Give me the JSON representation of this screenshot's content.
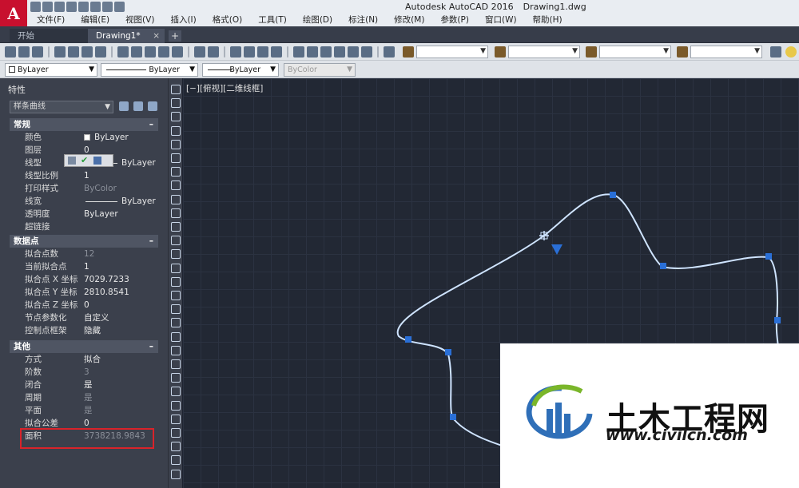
{
  "titlebar": {
    "app_name": "Autodesk AutoCAD 2016",
    "doc_name": "Drawing1.dwg",
    "app_button_letter": "A"
  },
  "menu": [
    "文件(F)",
    "编辑(E)",
    "视图(V)",
    "插入(I)",
    "格式(O)",
    "工具(T)",
    "绘图(D)",
    "标注(N)",
    "修改(M)",
    "参数(P)",
    "窗口(W)",
    "帮助(H)"
  ],
  "tabs": {
    "start": "开始",
    "active": "Drawing1*",
    "add": "+"
  },
  "layer_toolbar": {
    "color": "ByLayer",
    "linetype": "ByLayer",
    "lineweight": "ByLayer",
    "plotstyle": "ByColor"
  },
  "properties": {
    "panel_title": "特性",
    "object_type": "样条曲线",
    "sections": {
      "general": {
        "title": "常规",
        "rows": [
          {
            "label": "颜色",
            "value": "ByLayer"
          },
          {
            "label": "图层",
            "value": "0"
          },
          {
            "label": "线型",
            "value": "ByLayer"
          },
          {
            "label": "线型比例",
            "value": "1"
          },
          {
            "label": "打印样式",
            "value": "ByColor"
          },
          {
            "label": "线宽",
            "value": "ByLayer"
          },
          {
            "label": "透明度",
            "value": "ByLayer"
          },
          {
            "label": "超链接",
            "value": ""
          }
        ]
      },
      "data_points": {
        "title": "数据点",
        "rows": [
          {
            "label": "拟合点数",
            "value": "12"
          },
          {
            "label": "当前拟合点",
            "value": "1"
          },
          {
            "label": "拟合点 X 坐标",
            "value": "7029.7233"
          },
          {
            "label": "拟合点 Y 坐标",
            "value": "2810.8541"
          },
          {
            "label": "拟合点 Z 坐标",
            "value": "0"
          },
          {
            "label": "节点参数化",
            "value": "自定义"
          },
          {
            "label": "控制点框架",
            "value": "隐藏"
          }
        ]
      },
      "other": {
        "title": "其他",
        "rows": [
          {
            "label": "方式",
            "value": "拟合"
          },
          {
            "label": "阶数",
            "value": "3"
          },
          {
            "label": "闭合",
            "value": "是"
          },
          {
            "label": "周期",
            "value": "是"
          },
          {
            "label": "平面",
            "value": "是"
          },
          {
            "label": "拟合公差",
            "value": "0"
          },
          {
            "label": "面积",
            "value": "3738218.9843"
          }
        ]
      }
    }
  },
  "viewport": {
    "label": "[−][俯视][二维线框]"
  },
  "watermark": {
    "title": "土木工程网",
    "url": "www.civilcn.com"
  },
  "colors": {
    "spline": "#cfe4ff",
    "grip": "#2a6fd6",
    "highlight_box": "#d9232a",
    "app_red": "#c8102e"
  }
}
